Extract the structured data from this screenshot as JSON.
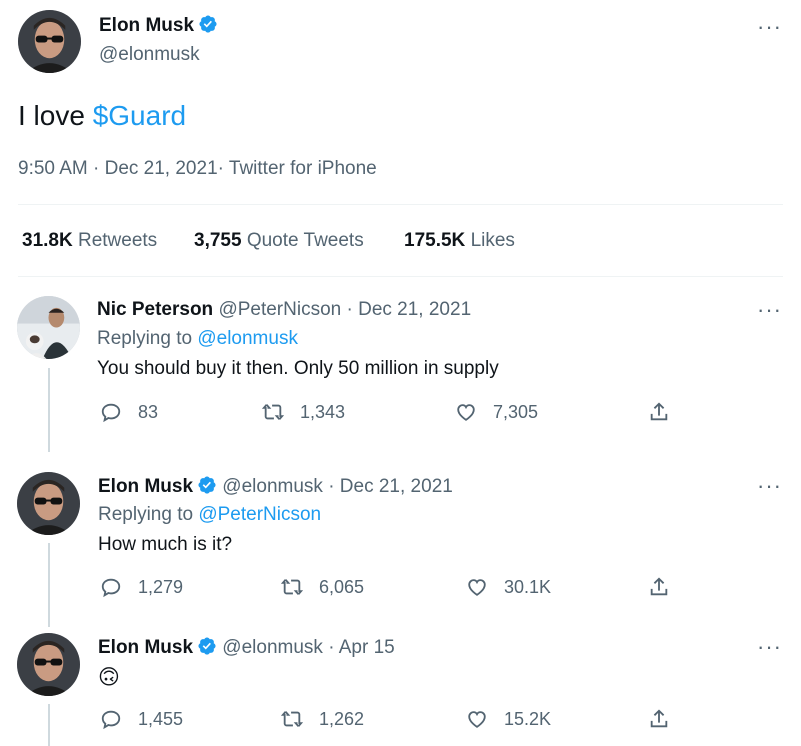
{
  "main_tweet": {
    "author_name": "Elon Musk",
    "author_handle": "@elonmusk",
    "text_prefix": "I love ",
    "text_cashtag": "$Guard",
    "time": "9:50 AM",
    "date": "Dec 21, 2021",
    "source": "Twitter for iPhone",
    "stats": {
      "retweets_count": "31.8K",
      "retweets_label": "Retweets",
      "quotes_count": "3,755",
      "quotes_label": "Quote Tweets",
      "likes_count": "175.5K",
      "likes_label": "Likes"
    }
  },
  "replies": [
    {
      "author_name": "Nic Peterson",
      "author_handle": "@PeterNicson",
      "date": "Dec 21, 2021",
      "replying_label": "Replying to",
      "replying_to": "@elonmusk",
      "text": "You should buy it then. Only 50 million in supply",
      "replies": "83",
      "retweets": "1,343",
      "likes": "7,305"
    },
    {
      "author_name": "Elon Musk",
      "author_handle": "@elonmusk",
      "date": "Dec 21, 2021",
      "replying_label": "Replying to",
      "replying_to": "@PeterNicson",
      "text": "How much is it?",
      "replies": "1,279",
      "retweets": "6,065",
      "likes": "30.1K"
    },
    {
      "author_name": "Elon Musk",
      "author_handle": "@elonmusk",
      "date": "Apr 15",
      "text": "🙃",
      "replies": "1,455",
      "retweets": "1,262",
      "likes": "15.2K"
    }
  ],
  "separator": "·",
  "colors": {
    "accent": "#1d9bf0",
    "text": "#0f1419",
    "muted": "#536471",
    "divider": "#eff3f4"
  },
  "icons": [
    "verified-badge-icon",
    "more-options-icon",
    "reply-icon",
    "retweet-icon",
    "like-icon",
    "share-icon"
  ]
}
